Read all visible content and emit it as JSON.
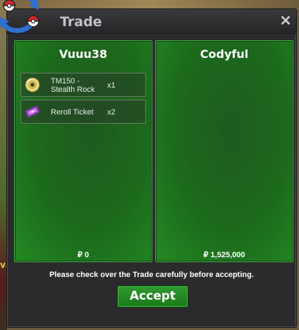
{
  "window": {
    "title": "Trade",
    "close_label": "✕"
  },
  "left_panel": {
    "player_name": "Vuuu38",
    "items": [
      {
        "name": "TM150 -\nStealth Rock",
        "quantity": "x1",
        "icon": "disc-icon"
      },
      {
        "name": "Reroll Ticket",
        "quantity": "x2",
        "icon": "ticket-icon"
      }
    ],
    "money": "₽ 0"
  },
  "right_panel": {
    "player_name": "Codyful",
    "items": [],
    "money": "₽ 1,525,000"
  },
  "footer": {
    "notice": "Please check over the Trade carefully before accepting.",
    "accept_label": "Accept"
  },
  "background": {
    "fragment_text": "va"
  },
  "colors": {
    "panel_green": "#1c6a1c",
    "panel_border": "#48b54a",
    "accept_green": "#197a19",
    "window_bg": "#2b2b2d"
  }
}
